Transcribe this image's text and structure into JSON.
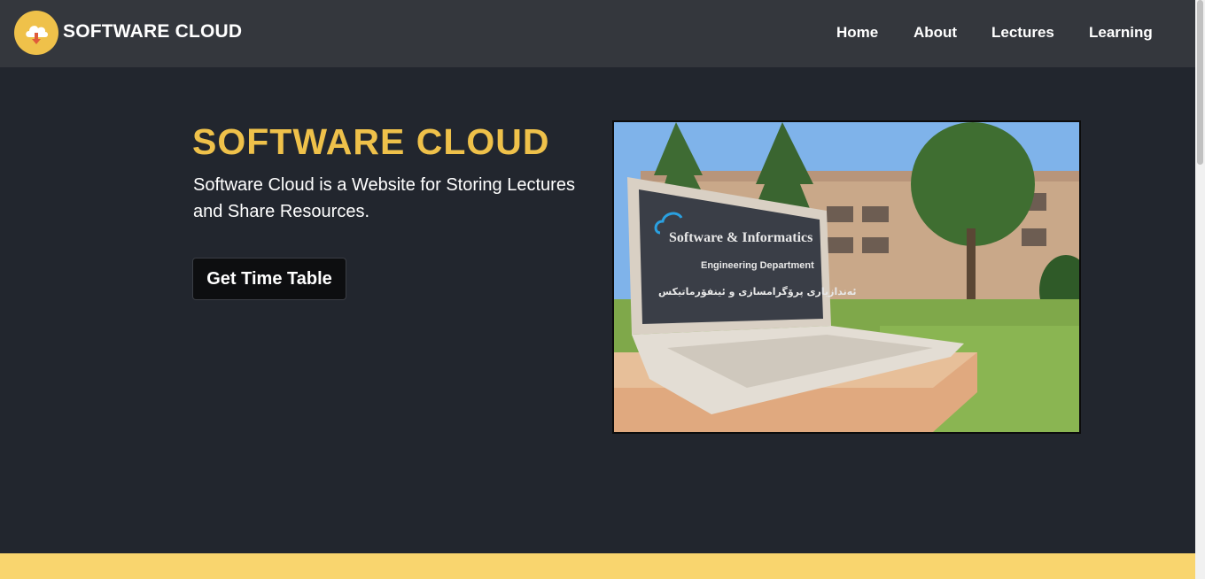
{
  "brand": {
    "name": "SOFTWARE CLOUD",
    "logo_icon": "cloud-download-icon",
    "logo_color": "#efc14a"
  },
  "nav": {
    "items": [
      {
        "label": "Home"
      },
      {
        "label": "About"
      },
      {
        "label": "Lectures"
      },
      {
        "label": "Learning"
      }
    ]
  },
  "hero": {
    "title": "SOFTWARE CLOUD",
    "description": "Software Cloud is a Website for Storing Lectures and Share Resources.",
    "cta_label": "Get Time Table",
    "image": {
      "sign_line1": "Software & Informatics",
      "sign_line2": "Engineering Department",
      "sign_line3": "ئەندازیاری پرۆگرامسازی و ئینفۆرماتیکس"
    }
  },
  "colors": {
    "background": "#22262e",
    "navbar": "#34373d",
    "accent": "#efc14a",
    "footer_band": "#f9d56e",
    "button": "#0d0e10"
  }
}
